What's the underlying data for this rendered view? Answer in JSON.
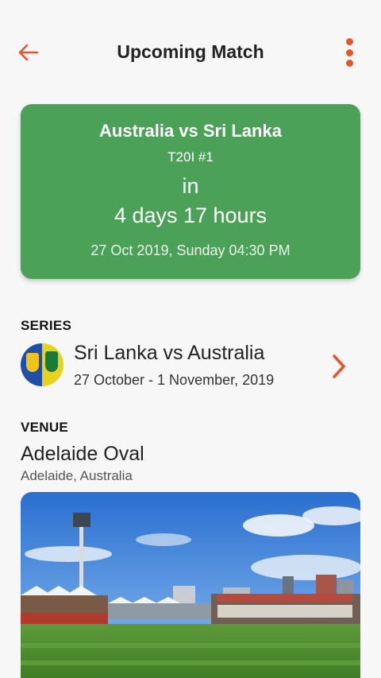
{
  "header": {
    "title": "Upcoming Match",
    "back_icon": "arrow-left-icon",
    "menu_icon": "more-vertical-icon",
    "accent_color": "#e4572e"
  },
  "match": {
    "teams": "Australia vs Sri Lanka",
    "match_number": "T20I #1",
    "in_label": "in",
    "countdown": "4 days 17 hours",
    "datetime": "27 Oct 2019, Sunday 04:30 PM",
    "card_color": "#4ca158"
  },
  "series": {
    "section_label": "SERIES",
    "name": "Sri Lanka vs Australia",
    "dates": "27 October - 1 November, 2019",
    "logo_icon": "series-logo-icon",
    "chevron_icon": "chevron-right-icon"
  },
  "venue": {
    "section_label": "VENUE",
    "name": "Adelaide Oval",
    "location": "Adelaide, Australia"
  }
}
